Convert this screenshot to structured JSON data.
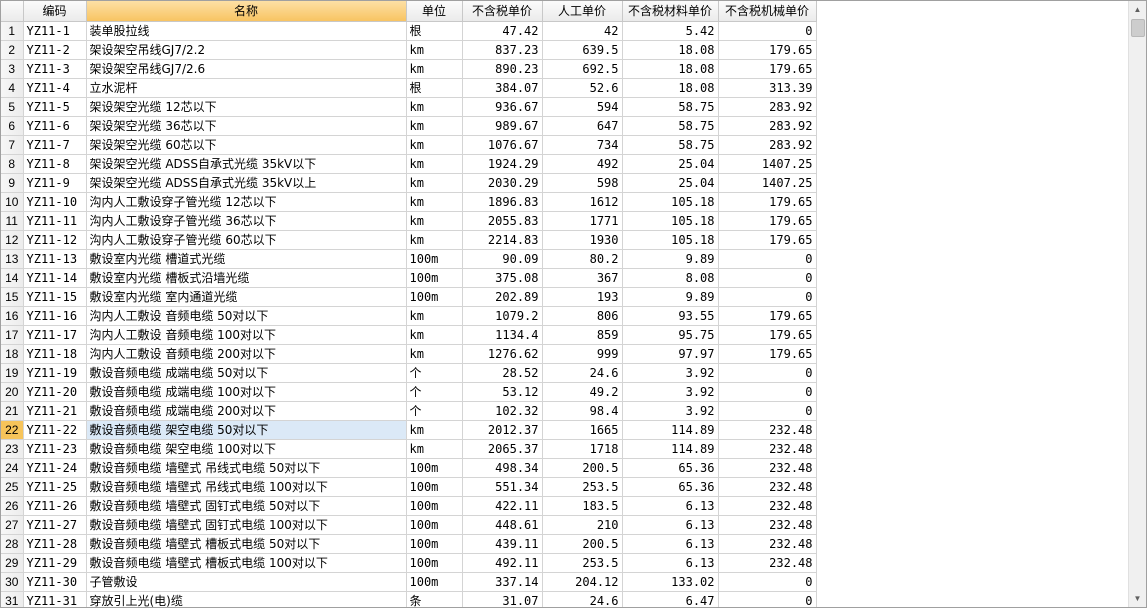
{
  "headers": {
    "code": "编码",
    "name": "名称",
    "unit": "单位",
    "price_ex_tax": "不含税单价",
    "labor": "人工单价",
    "material": "不含税材料单价",
    "machine": "不含税机械单价"
  },
  "selected_row": 22,
  "rows": [
    {
      "n": "1",
      "code": "YZ11-1",
      "name": "装单股拉线",
      "unit": "根",
      "price": "47.42",
      "labor": "42",
      "material": "5.42",
      "machine": "0"
    },
    {
      "n": "2",
      "code": "YZ11-2",
      "name": "架设架空吊线GJ7/2.2",
      "unit": "km",
      "price": "837.23",
      "labor": "639.5",
      "material": "18.08",
      "machine": "179.65"
    },
    {
      "n": "3",
      "code": "YZ11-3",
      "name": "架设架空吊线GJ7/2.6",
      "unit": "km",
      "price": "890.23",
      "labor": "692.5",
      "material": "18.08",
      "machine": "179.65"
    },
    {
      "n": "4",
      "code": "YZ11-4",
      "name": "立水泥杆",
      "unit": "根",
      "price": "384.07",
      "labor": "52.6",
      "material": "18.08",
      "machine": "313.39"
    },
    {
      "n": "5",
      "code": "YZ11-5",
      "name": "架设架空光缆 12芯以下",
      "unit": "km",
      "price": "936.67",
      "labor": "594",
      "material": "58.75",
      "machine": "283.92"
    },
    {
      "n": "6",
      "code": "YZ11-6",
      "name": "架设架空光缆 36芯以下",
      "unit": "km",
      "price": "989.67",
      "labor": "647",
      "material": "58.75",
      "machine": "283.92"
    },
    {
      "n": "7",
      "code": "YZ11-7",
      "name": "架设架空光缆 60芯以下",
      "unit": "km",
      "price": "1076.67",
      "labor": "734",
      "material": "58.75",
      "machine": "283.92"
    },
    {
      "n": "8",
      "code": "YZ11-8",
      "name": "架设架空光缆 ADSS自承式光缆 35kV以下",
      "unit": "km",
      "price": "1924.29",
      "labor": "492",
      "material": "25.04",
      "machine": "1407.25"
    },
    {
      "n": "9",
      "code": "YZ11-9",
      "name": "架设架空光缆 ADSS自承式光缆 35kV以上",
      "unit": "km",
      "price": "2030.29",
      "labor": "598",
      "material": "25.04",
      "machine": "1407.25"
    },
    {
      "n": "10",
      "code": "YZ11-10",
      "name": "沟内人工敷设穿子管光缆 12芯以下",
      "unit": "km",
      "price": "1896.83",
      "labor": "1612",
      "material": "105.18",
      "machine": "179.65"
    },
    {
      "n": "11",
      "code": "YZ11-11",
      "name": "沟内人工敷设穿子管光缆 36芯以下",
      "unit": "km",
      "price": "2055.83",
      "labor": "1771",
      "material": "105.18",
      "machine": "179.65"
    },
    {
      "n": "12",
      "code": "YZ11-12",
      "name": "沟内人工敷设穿子管光缆 60芯以下",
      "unit": "km",
      "price": "2214.83",
      "labor": "1930",
      "material": "105.18",
      "machine": "179.65"
    },
    {
      "n": "13",
      "code": "YZ11-13",
      "name": "敷设室内光缆 槽道式光缆",
      "unit": "100m",
      "price": "90.09",
      "labor": "80.2",
      "material": "9.89",
      "machine": "0"
    },
    {
      "n": "14",
      "code": "YZ11-14",
      "name": "敷设室内光缆 槽板式沿墙光缆",
      "unit": "100m",
      "price": "375.08",
      "labor": "367",
      "material": "8.08",
      "machine": "0"
    },
    {
      "n": "15",
      "code": "YZ11-15",
      "name": "敷设室内光缆 室内通道光缆",
      "unit": "100m",
      "price": "202.89",
      "labor": "193",
      "material": "9.89",
      "machine": "0"
    },
    {
      "n": "16",
      "code": "YZ11-16",
      "name": "沟内人工敷设 音频电缆 50对以下",
      "unit": "km",
      "price": "1079.2",
      "labor": "806",
      "material": "93.55",
      "machine": "179.65"
    },
    {
      "n": "17",
      "code": "YZ11-17",
      "name": "沟内人工敷设 音频电缆 100对以下",
      "unit": "km",
      "price": "1134.4",
      "labor": "859",
      "material": "95.75",
      "machine": "179.65"
    },
    {
      "n": "18",
      "code": "YZ11-18",
      "name": "沟内人工敷设 音频电缆 200对以下",
      "unit": "km",
      "price": "1276.62",
      "labor": "999",
      "material": "97.97",
      "machine": "179.65"
    },
    {
      "n": "19",
      "code": "YZ11-19",
      "name": "敷设音频电缆 成端电缆 50对以下",
      "unit": "个",
      "price": "28.52",
      "labor": "24.6",
      "material": "3.92",
      "machine": "0"
    },
    {
      "n": "20",
      "code": "YZ11-20",
      "name": "敷设音频电缆 成端电缆 100对以下",
      "unit": "个",
      "price": "53.12",
      "labor": "49.2",
      "material": "3.92",
      "machine": "0"
    },
    {
      "n": "21",
      "code": "YZ11-21",
      "name": "敷设音频电缆 成端电缆 200对以下",
      "unit": "个",
      "price": "102.32",
      "labor": "98.4",
      "material": "3.92",
      "machine": "0"
    },
    {
      "n": "22",
      "code": "YZ11-22",
      "name": "敷设音频电缆 架空电缆 50对以下",
      "unit": "km",
      "price": "2012.37",
      "labor": "1665",
      "material": "114.89",
      "machine": "232.48"
    },
    {
      "n": "23",
      "code": "YZ11-23",
      "name": "敷设音频电缆 架空电缆 100对以下",
      "unit": "km",
      "price": "2065.37",
      "labor": "1718",
      "material": "114.89",
      "machine": "232.48"
    },
    {
      "n": "24",
      "code": "YZ11-24",
      "name": "敷设音频电缆 墙壁式 吊线式电缆 50对以下",
      "unit": "100m",
      "price": "498.34",
      "labor": "200.5",
      "material": "65.36",
      "machine": "232.48"
    },
    {
      "n": "25",
      "code": "YZ11-25",
      "name": "敷设音频电缆 墙壁式 吊线式电缆 100对以下",
      "unit": "100m",
      "price": "551.34",
      "labor": "253.5",
      "material": "65.36",
      "machine": "232.48"
    },
    {
      "n": "26",
      "code": "YZ11-26",
      "name": "敷设音频电缆 墙壁式 固钉式电缆 50对以下",
      "unit": "100m",
      "price": "422.11",
      "labor": "183.5",
      "material": "6.13",
      "machine": "232.48"
    },
    {
      "n": "27",
      "code": "YZ11-27",
      "name": "敷设音频电缆 墙壁式 固钉式电缆 100对以下",
      "unit": "100m",
      "price": "448.61",
      "labor": "210",
      "material": "6.13",
      "machine": "232.48"
    },
    {
      "n": "28",
      "code": "YZ11-28",
      "name": "敷设音频电缆 墙壁式 槽板式电缆 50对以下",
      "unit": "100m",
      "price": "439.11",
      "labor": "200.5",
      "material": "6.13",
      "machine": "232.48"
    },
    {
      "n": "29",
      "code": "YZ11-29",
      "name": "敷设音频电缆 墙壁式 槽板式电缆 100对以下",
      "unit": "100m",
      "price": "492.11",
      "labor": "253.5",
      "material": "6.13",
      "machine": "232.48"
    },
    {
      "n": "30",
      "code": "YZ11-30",
      "name": "子管敷设",
      "unit": "100m",
      "price": "337.14",
      "labor": "204.12",
      "material": "133.02",
      "machine": "0"
    },
    {
      "n": "31",
      "code": "YZ11-31",
      "name": "穿放引上光(电)缆",
      "unit": "条",
      "price": "31.07",
      "labor": "24.6",
      "material": "6.47",
      "machine": "0"
    }
  ]
}
